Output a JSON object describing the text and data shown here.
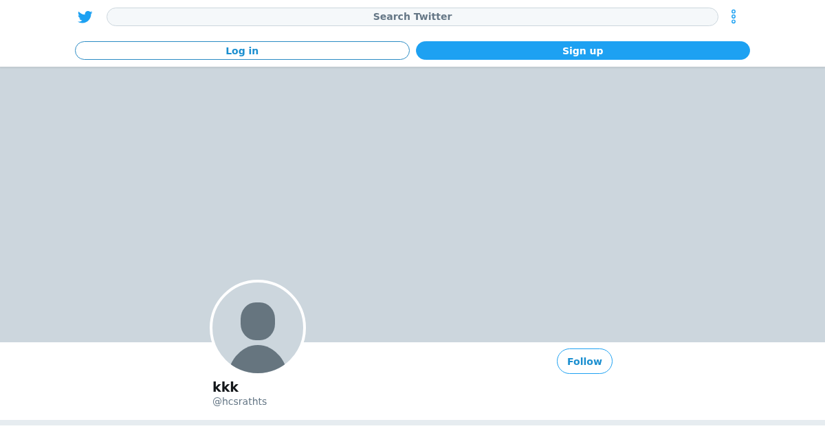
{
  "header": {
    "search": {
      "placeholder": "Search Twitter"
    },
    "buttons": [
      {
        "label": "Log in",
        "kind": "outline"
      },
      {
        "label": "Sign up",
        "kind": "filled"
      }
    ]
  },
  "profile": {
    "name": "kkk",
    "handle": "@hcsrathts",
    "follow_button": "Follow"
  }
}
